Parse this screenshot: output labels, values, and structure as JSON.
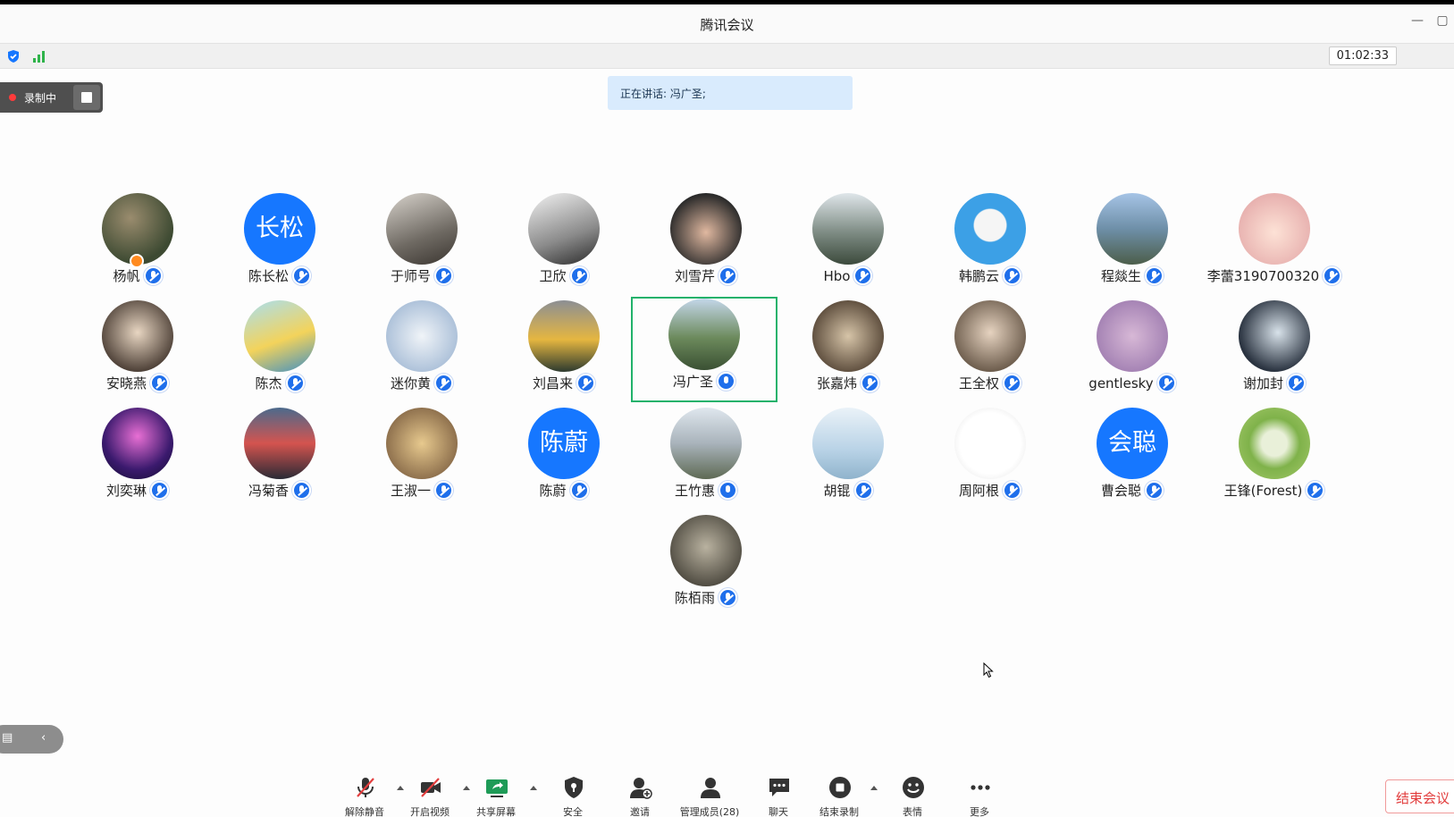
{
  "window": {
    "title": "腾讯会议"
  },
  "status": {
    "timer": "01:02:33"
  },
  "recording": {
    "label": "录制中"
  },
  "speaking_banner": {
    "text": "正在讲话: 冯广圣;"
  },
  "colors": {
    "accent": "#1677ff",
    "active_speaker_border": "#21b26b",
    "end_red": "#e23d3d",
    "recording_dot": "#ff3b3b"
  },
  "participants": [
    {
      "name": "杨帆",
      "avatar_text": "",
      "mic": "muted",
      "host": true
    },
    {
      "name": "陈长松",
      "avatar_text": "长松",
      "mic": "muted"
    },
    {
      "name": "于师号",
      "avatar_text": "",
      "mic": "muted"
    },
    {
      "name": "卫欣",
      "avatar_text": "",
      "mic": "muted"
    },
    {
      "name": "刘雪芹",
      "avatar_text": "",
      "mic": "muted"
    },
    {
      "name": "Hbo",
      "avatar_text": "",
      "mic": "muted"
    },
    {
      "name": "韩鹏云",
      "avatar_text": "",
      "mic": "muted"
    },
    {
      "name": "程燚生",
      "avatar_text": "",
      "mic": "muted"
    },
    {
      "name": "李蕾3190700320",
      "avatar_text": "",
      "mic": "muted"
    },
    {
      "name": "安晓燕",
      "avatar_text": "",
      "mic": "muted"
    },
    {
      "name": "陈杰",
      "avatar_text": "",
      "mic": "muted"
    },
    {
      "name": "迷你黄",
      "avatar_text": "",
      "mic": "muted"
    },
    {
      "name": "刘昌来",
      "avatar_text": "",
      "mic": "muted"
    },
    {
      "name": "冯广圣",
      "avatar_text": "",
      "mic": "on",
      "active": true
    },
    {
      "name": "张嘉炜",
      "avatar_text": "",
      "mic": "muted"
    },
    {
      "name": "王全权",
      "avatar_text": "",
      "mic": "muted"
    },
    {
      "name": "gentlesky",
      "avatar_text": "",
      "mic": "muted"
    },
    {
      "name": "谢加封",
      "avatar_text": "",
      "mic": "muted"
    },
    {
      "name": "刘奕琳",
      "avatar_text": "",
      "mic": "muted"
    },
    {
      "name": "冯菊香",
      "avatar_text": "",
      "mic": "muted"
    },
    {
      "name": "王淑一",
      "avatar_text": "",
      "mic": "muted"
    },
    {
      "name": "陈蔚",
      "avatar_text": "陈蔚",
      "mic": "muted"
    },
    {
      "name": "王竹惠",
      "avatar_text": "",
      "mic": "on"
    },
    {
      "name": "胡锟",
      "avatar_text": "",
      "mic": "muted"
    },
    {
      "name": "周阿根",
      "avatar_text": "",
      "mic": "muted"
    },
    {
      "name": "曹会聪",
      "avatar_text": "会聪",
      "mic": "muted"
    },
    {
      "name": "王锋(Forest)",
      "avatar_text": "",
      "mic": "muted"
    },
    {
      "name": "陈栢雨",
      "avatar_text": "",
      "mic": "muted"
    }
  ],
  "toolbar": {
    "unmute": "解除静音",
    "video": "开启视频",
    "share": "共享屏幕",
    "security": "安全",
    "invite": "邀请",
    "members": "管理成员(28)",
    "chat": "聊天",
    "stop_recording": "结束录制",
    "reactions": "表情",
    "more": "更多",
    "end": "结束会议"
  },
  "icons": [
    "shield-icon",
    "signal-icon",
    "mic-muted-icon",
    "video-off-icon",
    "share-screen-icon",
    "security-icon",
    "invite-icon",
    "members-icon",
    "chat-icon",
    "stop-record-icon",
    "emoji-icon",
    "more-icon"
  ]
}
